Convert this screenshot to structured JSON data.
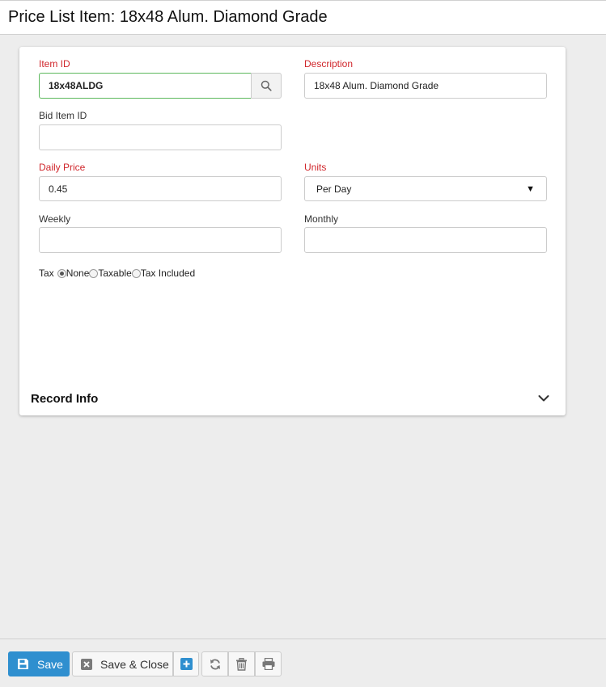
{
  "header": {
    "title": "Price List Item: 18x48 Alum. Diamond Grade"
  },
  "form": {
    "item_id": {
      "label": "Item ID",
      "value": "18x48ALDG"
    },
    "description": {
      "label": "Description",
      "value": "18x48 Alum. Diamond Grade"
    },
    "bid_item_id": {
      "label": "Bid Item ID",
      "value": ""
    },
    "daily_price": {
      "label": "Daily Price",
      "value": "0.45"
    },
    "units": {
      "label": "Units",
      "value": "Per Day"
    },
    "weekly": {
      "label": "Weekly",
      "value": ""
    },
    "monthly": {
      "label": "Monthly",
      "value": ""
    },
    "tax": {
      "label": "Tax",
      "options": [
        "None",
        "Taxable",
        "Tax Included"
      ],
      "selected": "None"
    }
  },
  "record_info": {
    "label": "Record Info"
  },
  "footer": {
    "save_label": "Save",
    "save_close_label": "Save & Close"
  },
  "colors": {
    "required_label": "#d0262b",
    "primary_button": "#2f8fcf",
    "focus_border": "#5cb85c"
  }
}
